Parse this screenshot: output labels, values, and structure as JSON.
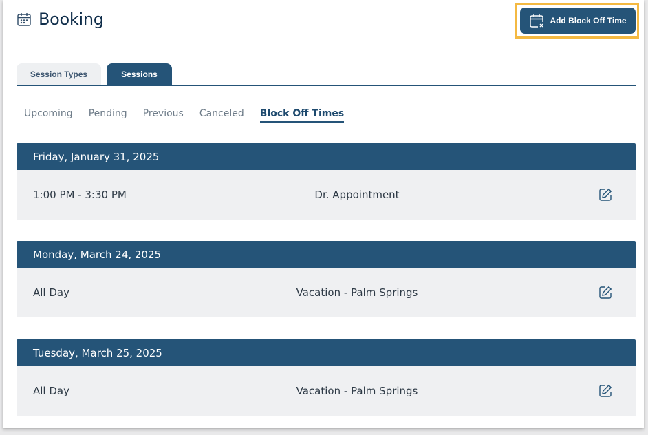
{
  "header": {
    "title": "Booking",
    "title_icon": "calendar-icon"
  },
  "add_button": {
    "label": "Add Block Off Time",
    "icon": "calendar-x-icon"
  },
  "tabs": [
    {
      "label": "Session Types",
      "active": false
    },
    {
      "label": "Sessions",
      "active": true
    }
  ],
  "subnav": [
    {
      "label": "Upcoming",
      "active": false
    },
    {
      "label": "Pending",
      "active": false
    },
    {
      "label": "Previous",
      "active": false
    },
    {
      "label": "Canceled",
      "active": false
    },
    {
      "label": "Block Off Times",
      "active": true
    }
  ],
  "groups": [
    {
      "date": "Friday, January 31, 2025",
      "time": "1:00 PM - 3:30 PM",
      "label": "Dr. Appointment"
    },
    {
      "date": "Monday, March 24, 2025",
      "time": "All Day",
      "label": "Vacation - Palm Springs"
    },
    {
      "date": "Tuesday, March 25, 2025",
      "time": "All Day",
      "label": "Vacation - Palm Springs"
    }
  ],
  "colors": {
    "primary": "#255478",
    "highlight": "#f4b942",
    "row_bg": "#eff0f2"
  }
}
